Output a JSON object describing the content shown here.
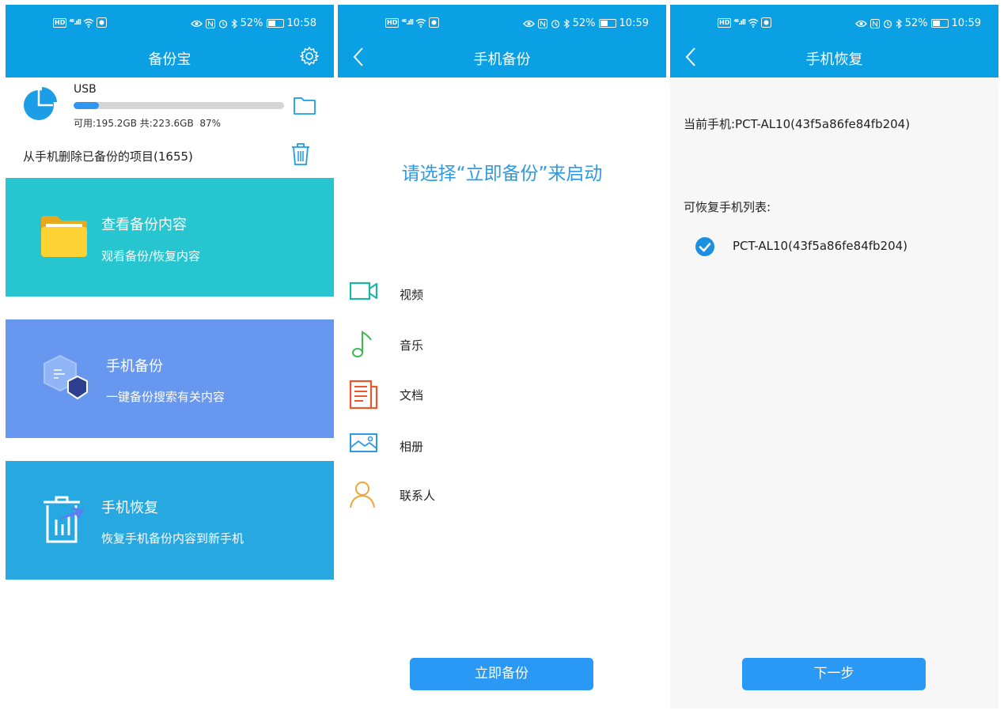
{
  "screens": {
    "backup_home": {
      "status": {
        "left": "HD ⁴⁶.ıll",
        "right_pct": "52%",
        "time": "10:58"
      },
      "title": "备份宝",
      "storage": {
        "name": "USB",
        "usage_text": "可用:195.2GB 共:223.6GB",
        "percent_text": "87%",
        "bar_fraction": 0.12
      },
      "delete_label": "从手机删除已备份的项目(1655)",
      "cards": [
        {
          "title": "查看备份内容",
          "subtitle": "观看备份/恢复内容",
          "color": "#26c5cf"
        },
        {
          "title": "手机备份",
          "subtitle": "一键备份搜索有关内容",
          "color": "#6797ef"
        },
        {
          "title": "手机恢复",
          "subtitle": "恢复手机备份内容到新手机",
          "color": "#28a8e1"
        }
      ]
    },
    "phone_backup": {
      "status": {
        "left": "HD ⁴⁶.ıll",
        "right_pct": "52%",
        "time": "10:59"
      },
      "title": "手机备份",
      "prompt": "请选择“立即备份”来启动",
      "items": [
        {
          "label": "视频",
          "icon": "video-icon",
          "color": "#1bb5a8"
        },
        {
          "label": "音乐",
          "icon": "music-note-icon",
          "color": "#3dba4e"
        },
        {
          "label": "文档",
          "icon": "document-icon",
          "color": "#e8572e"
        },
        {
          "label": "相册",
          "icon": "photo-album-icon",
          "color": "#2e9ae3"
        },
        {
          "label": "联系人",
          "icon": "contact-person-icon",
          "color": "#f0a636"
        }
      ],
      "button": "立即备份"
    },
    "phone_restore": {
      "status": {
        "left": "HD ⁴⁶.ıll",
        "right_pct": "52%",
        "time": "10:59"
      },
      "title": "手机恢复",
      "current_phone": "当前手机:PCT-AL10(43f5a86fe84fb204)",
      "list_label": "可恢复手机列表:",
      "devices": [
        {
          "label": "PCT-AL10(43f5a86fe84fb204)",
          "checked": true
        }
      ],
      "button": "下一步"
    }
  },
  "colors": {
    "accent": "#0b9fe3",
    "button": "#2a98f5",
    "bar_track": "#d5d5d5"
  }
}
